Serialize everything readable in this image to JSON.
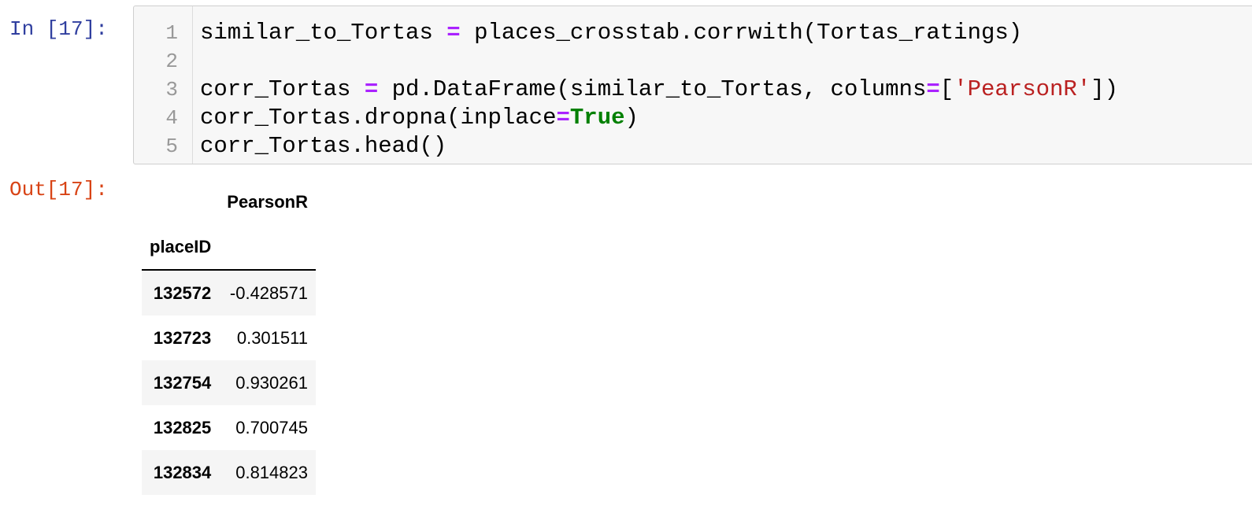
{
  "input_prompt": "In [17]:",
  "output_prompt": "Out[17]:",
  "code_lines": [
    {
      "n": "1",
      "parts": [
        [
          "similar_to_Tortas ",
          ""
        ],
        [
          "=",
          "op"
        ],
        [
          " places_crosstab.corrwith(Tortas_ratings)",
          ""
        ]
      ]
    },
    {
      "n": "2",
      "parts": []
    },
    {
      "n": "3",
      "parts": [
        [
          "corr_Tortas ",
          ""
        ],
        [
          "=",
          "op"
        ],
        [
          " pd.DataFrame(similar_to_Tortas, columns",
          ""
        ],
        [
          "=",
          "op"
        ],
        [
          "[",
          ""
        ],
        [
          "'PearsonR'",
          "str"
        ],
        [
          "])",
          ""
        ]
      ]
    },
    {
      "n": "4",
      "parts": [
        [
          "corr_Tortas.dropna(inplace",
          ""
        ],
        [
          "=",
          "op"
        ],
        [
          "True",
          "kw"
        ],
        [
          ")",
          ""
        ]
      ]
    },
    {
      "n": "5",
      "parts": [
        [
          "corr_Tortas.head()",
          ""
        ]
      ]
    }
  ],
  "table": {
    "column_header": "PearsonR",
    "index_name": "placeID",
    "rows": [
      {
        "index": "132572",
        "value": "-0.428571"
      },
      {
        "index": "132723",
        "value": "0.301511"
      },
      {
        "index": "132754",
        "value": "0.930261"
      },
      {
        "index": "132825",
        "value": "0.700745"
      },
      {
        "index": "132834",
        "value": "0.814823"
      }
    ]
  }
}
